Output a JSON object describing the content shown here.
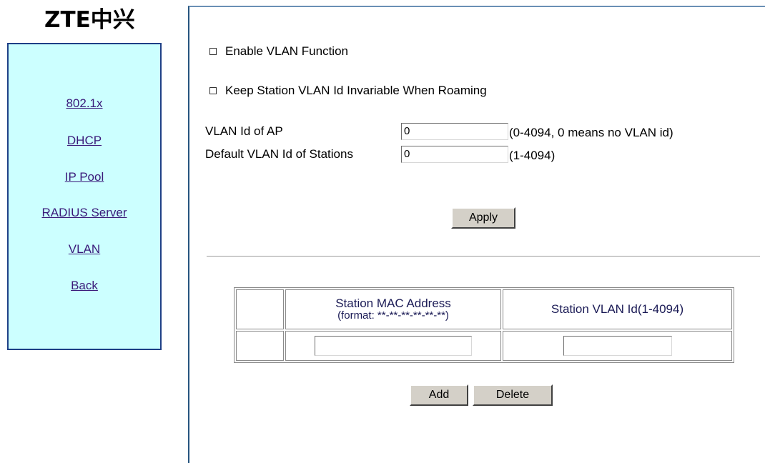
{
  "brand": {
    "logo_text": "ZTE中兴"
  },
  "sidebar": {
    "items": [
      {
        "label": "802.1x"
      },
      {
        "label": "DHCP"
      },
      {
        "label": "IP Pool"
      },
      {
        "label": "RADIUS Server"
      },
      {
        "label": "VLAN"
      },
      {
        "label": "Back"
      }
    ]
  },
  "vlan": {
    "enable_label": "Enable VLAN Function",
    "enable_checked": false,
    "keep_label": "Keep Station VLAN Id Invariable When Roaming",
    "keep_checked": false,
    "ap_vlan_label": "VLAN Id of AP",
    "ap_vlan_value": "0",
    "ap_vlan_hint": "(0-4094, 0 means no VLAN id)",
    "default_vlan_label": "Default VLAN Id of Stations",
    "default_vlan_value": "0",
    "default_vlan_hint": "(1-4094)",
    "apply_label": "Apply"
  },
  "station_table": {
    "mac_header_line1": "Station MAC Address",
    "mac_header_line2": "(format: **-**-**-**-**-**)",
    "vlan_header": "Station VLAN Id(1-4094)",
    "mac_value": "",
    "vlan_value": ""
  },
  "actions": {
    "add_label": "Add",
    "delete_label": "Delete"
  }
}
